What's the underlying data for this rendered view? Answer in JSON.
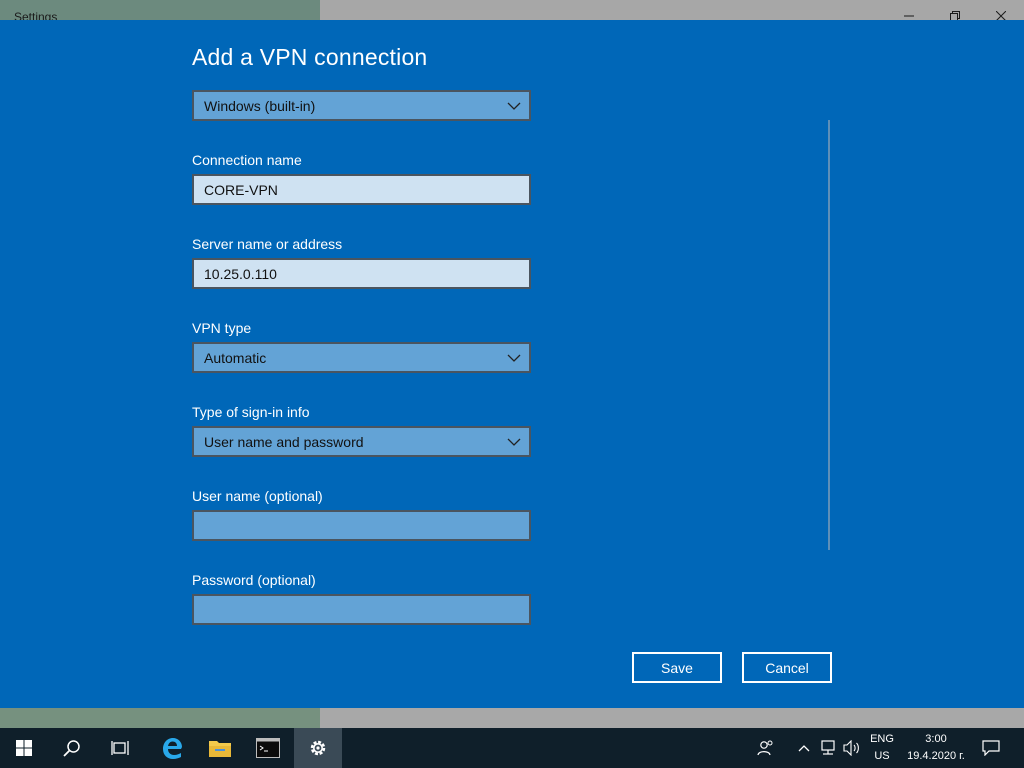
{
  "window": {
    "app_title": "Settings"
  },
  "dialog": {
    "title": "Add a VPN connection",
    "provider": {
      "value": "Windows (built-in)"
    },
    "connection_name": {
      "label": "Connection name",
      "value": "CORE-VPN"
    },
    "server": {
      "label": "Server name or address",
      "value": "10.25.0.110"
    },
    "vpn_type": {
      "label": "VPN type",
      "value": "Automatic"
    },
    "signin_type": {
      "label": "Type of sign-in info",
      "value": "User name and password"
    },
    "username": {
      "label": "User name (optional)",
      "value": ""
    },
    "password": {
      "label": "Password (optional)",
      "value": ""
    },
    "save_label": "Save",
    "cancel_label": "Cancel"
  },
  "taskbar": {
    "items": [
      "start-icon",
      "search-icon",
      "task-view-icon",
      "edge-icon",
      "file-explorer-icon",
      "terminal-icon",
      "settings-icon"
    ],
    "tray": {
      "language_top": "ENG",
      "language_bottom": "US",
      "time": "3:00",
      "date": "19.4.2020 г."
    }
  },
  "colors": {
    "dialog_bg": "#0067b8",
    "dropdown_bg": "#63a3d6",
    "filled_input_bg": "#cfe2f2",
    "taskbar_bg": "#0f1f2a"
  }
}
